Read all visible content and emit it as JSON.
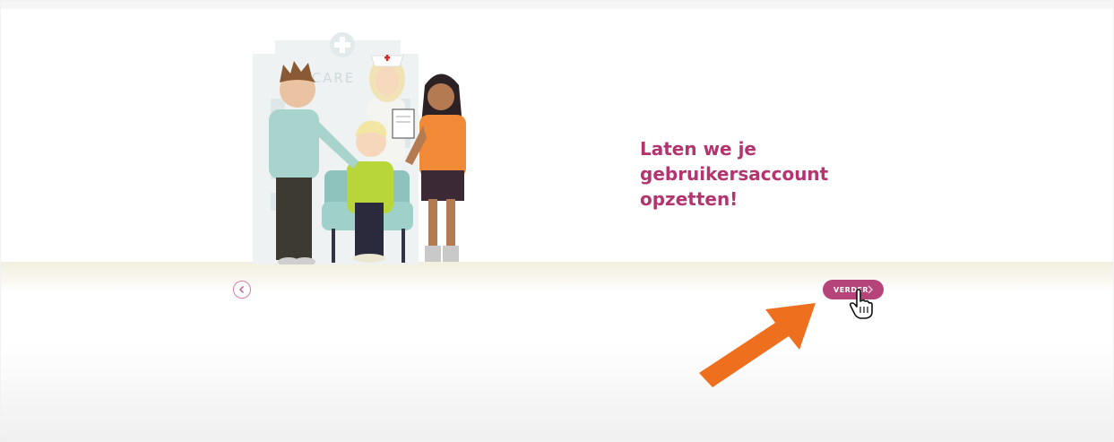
{
  "headline": {
    "line1": "Laten we je",
    "line2": "gebruikersaccount",
    "line3": "opzetten!"
  },
  "illustration": {
    "building_sign": "CARE"
  },
  "navigation": {
    "back_icon": "chevron-left-icon",
    "next_label": "VERDER",
    "next_icon": "chevron-right-icon"
  },
  "colors": {
    "accent": "#b3346f",
    "button": "#b5447a",
    "arrow": "#ee6f1e"
  }
}
